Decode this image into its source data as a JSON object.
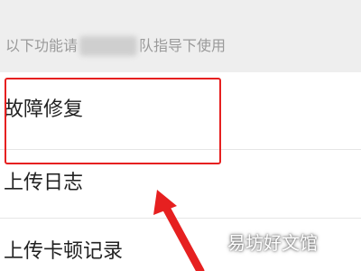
{
  "hint": {
    "prefix": "以下功能请",
    "suffix": "队指导下使用"
  },
  "menu": {
    "items": [
      {
        "label": "故障修复"
      },
      {
        "label": "上传日志"
      },
      {
        "label": "上传卡顿记录"
      }
    ]
  },
  "annotation": {
    "highlight_color": "#e62020",
    "arrow_color": "#e62020"
  },
  "watermark": "易坊好文馆"
}
